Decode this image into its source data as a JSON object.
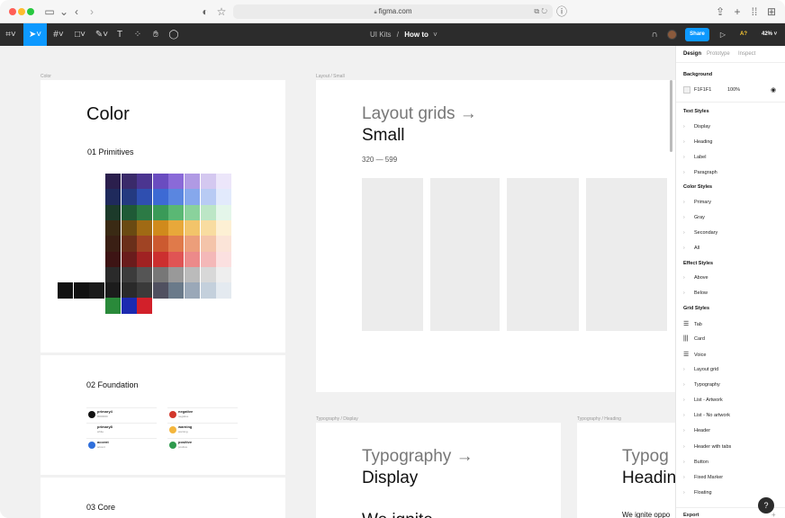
{
  "browser": {
    "url": "figma.com"
  },
  "toolbar": {
    "file": "UI Kits",
    "separator": "/",
    "page": "How to",
    "share_label": "Share",
    "a7_label": "A?",
    "zoom": "42%"
  },
  "canvas": {
    "color_frame": {
      "label": "Color",
      "title": "Color",
      "section": "01 Primitives"
    },
    "foundation_frame": {
      "title": "02 Foundation",
      "items": [
        {
          "name": "primary4",
          "value": "#000000",
          "color": "#111111"
        },
        {
          "name": "negative",
          "value": "negative",
          "color": "#d2382c"
        },
        {
          "name": "primary8",
          "value": "white",
          "color": "#ffffff"
        },
        {
          "name": "warning",
          "value": "warning",
          "color": "#f4b63d"
        },
        {
          "name": "accent",
          "value": "accent",
          "color": "#2f6fdb"
        },
        {
          "name": "positive",
          "value": "positive",
          "color": "#2f9a4d"
        }
      ]
    },
    "core_frame": {
      "title": "03 Core"
    },
    "layout_frame": {
      "label": "Layout / Small",
      "title": "Layout grids →",
      "subtitle": "Small",
      "range": "320 — 599"
    },
    "typo_display_frame": {
      "label": "Typography / Display",
      "title": "Typography →",
      "subtitle": "Display",
      "body": "We ignite"
    },
    "typo_heading_frame": {
      "label": "Typography / Heading",
      "title": "Typog",
      "subtitle": "Headin",
      "body": "We ignite oppo"
    }
  },
  "panel": {
    "tabs": [
      "Design",
      "Prototype",
      "Inspect"
    ],
    "background": {
      "title": "Background",
      "hex": "F1F1F1",
      "opacity": "100%"
    },
    "text_styles": {
      "title": "Text Styles",
      "items": [
        "Display",
        "Heading",
        "Label",
        "Paragraph"
      ]
    },
    "color_styles": {
      "title": "Color Styles",
      "items": [
        "Primary",
        "Gray",
        "Secondary",
        "All"
      ]
    },
    "effect_styles": {
      "title": "Effect Styles",
      "items": [
        "Above",
        "Below"
      ]
    },
    "grid_styles": {
      "title": "Grid Styles",
      "icon_items": [
        "Tab",
        "Card",
        "Voice"
      ],
      "items": [
        "Layout grid",
        "Typography",
        "List - Artwork",
        "List - No artwork",
        "Header",
        "Header with tabs",
        "Button",
        "Fixed Marker",
        "Floating"
      ]
    },
    "export_label": "Export",
    "help_label": "?"
  }
}
